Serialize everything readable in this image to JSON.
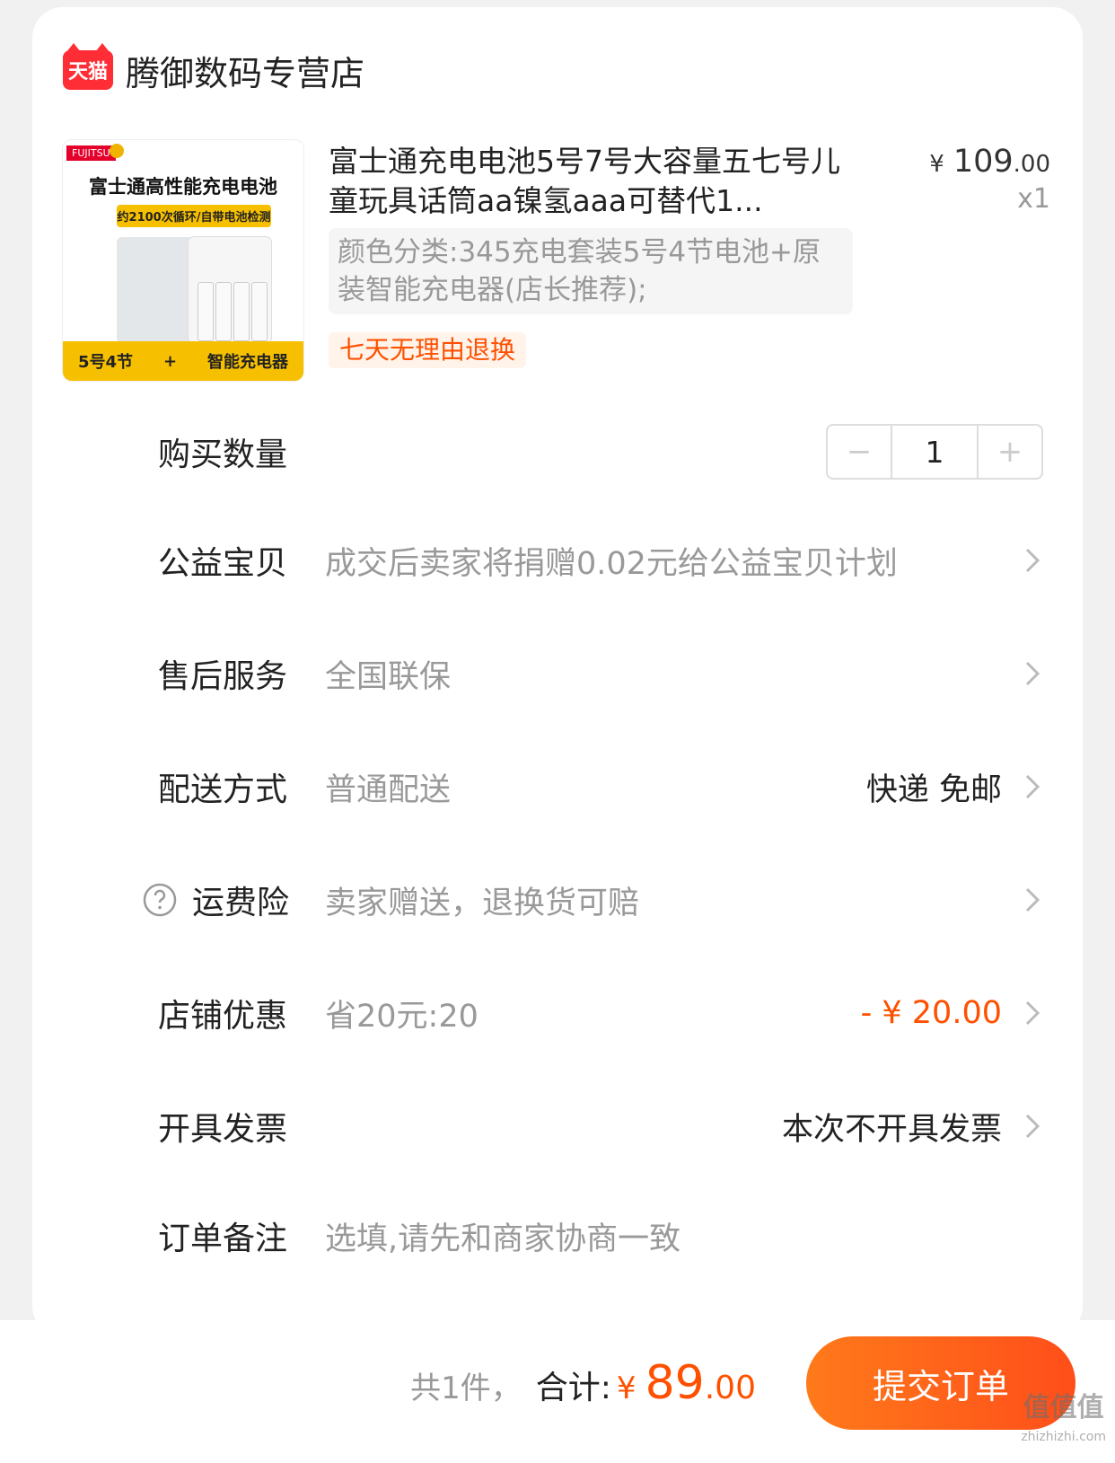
{
  "shop": {
    "badge": "天猫",
    "name": "腾御数码专营店"
  },
  "product": {
    "title": "富士通充电电池5号7号大容量五七号儿童玩具话筒aa镍氢aaa可替代1...",
    "price_yen": "¥",
    "price_int": "109",
    "price_dec": ".00",
    "quantity_label": "x1",
    "sku": "颜色分类:345充电套装5号4节电池+原装智能充电器(店长推荐);",
    "tag": "七天无理由退换",
    "image": {
      "brand": "FUJITSU",
      "headline": "富士通高性能充电电池",
      "sub": "约2100次循环/自带电池检测",
      "bottom_left": "5号4节",
      "plus": "+",
      "bottom_right": "智能充电器"
    }
  },
  "rows": {
    "quantity": {
      "label": "购买数量",
      "value": "1",
      "minus": "−",
      "plus": "+"
    },
    "charity": {
      "label": "公益宝贝",
      "value": "成交后卖家将捐赠0.02元给公益宝贝计划"
    },
    "after_sales": {
      "label": "售后服务",
      "value": "全国联保"
    },
    "delivery": {
      "label": "配送方式",
      "value": "普通配送",
      "right": "快递 免邮"
    },
    "shipping_insurance": {
      "label": "运费险",
      "value": "卖家赠送，退换货可赔"
    },
    "shop_discount": {
      "label": "店铺优惠",
      "value": "省20元:20",
      "right": "- ¥ 20.00"
    },
    "invoice": {
      "label": "开具发票",
      "right": "本次不开具发票"
    },
    "remark": {
      "label": "订单备注",
      "placeholder": "选填,请先和商家协商一致"
    }
  },
  "footer": {
    "count": "共1件，",
    "sum_label": "合计:",
    "yen": "¥",
    "amount": "89",
    "amount_dec": ".00",
    "submit": "提交订单"
  },
  "watermark": {
    "text": "值值值",
    "sub": "zhizhizhi.com"
  },
  "colors": {
    "accent": "#ff5000",
    "tmall_red": "#ff2d36",
    "muted": "#999999",
    "bg": "#f1f1f1"
  }
}
